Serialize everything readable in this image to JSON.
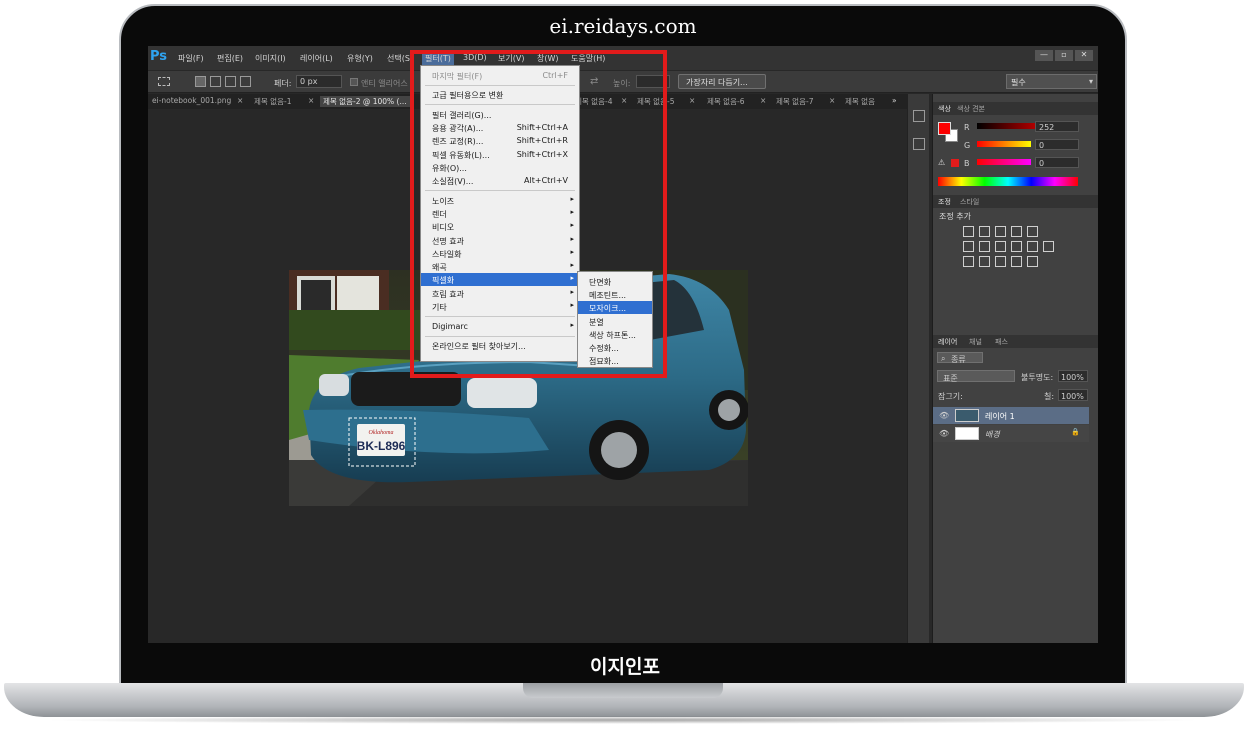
{
  "site_title": "ei.reidays.com",
  "bottom_label": "이지인포",
  "app": {
    "logo": "Ps",
    "menus": [
      "파일(F)",
      "편집(E)",
      "이미지(I)",
      "레이어(L)",
      "유형(Y)",
      "선택(S)",
      "필터(T)",
      "3D(D)",
      "보기(V)",
      "창(W)",
      "도움말(H)"
    ],
    "window_buttons": [
      "—",
      "▫",
      "✕"
    ]
  },
  "options_bar": {
    "feather_label": "페더:",
    "feather_value": "0 px",
    "antialias_label": "앤티 앨리어스",
    "height_label": "높이:",
    "refine_edge": "가장자리 다듬기...",
    "workspace": "필수"
  },
  "tabs": [
    "ei-notebook_001.png",
    "제목 없음-1",
    "제목 없음-2 @ 100% (...",
    "제목 없음-4",
    "제목 없음-5",
    "제목 없음-6",
    "제목 없음-7",
    "제목 없음"
  ],
  "tab_close": "×",
  "tab_overflow": "»",
  "filter_menu": {
    "items": [
      {
        "label": "마지막 필터(F)",
        "shortcut": "Ctrl+F",
        "disabled": true
      },
      {
        "label": "고급 필터용으로 변환",
        "shortcut": ""
      },
      {
        "label": "필터 갤러리(G)...",
        "shortcut": ""
      },
      {
        "label": "응용 광각(A)...",
        "shortcut": "Shift+Ctrl+A"
      },
      {
        "label": "렌즈 교정(R)...",
        "shortcut": "Shift+Ctrl+R"
      },
      {
        "label": "픽셀 유동화(L)...",
        "shortcut": "Shift+Ctrl+X"
      },
      {
        "label": "유화(O)...",
        "shortcut": ""
      },
      {
        "label": "소실점(V)...",
        "shortcut": "Alt+Ctrl+V"
      },
      {
        "label": "노이즈"
      },
      {
        "label": "렌더"
      },
      {
        "label": "비디오"
      },
      {
        "label": "선명 효과"
      },
      {
        "label": "스타일화"
      },
      {
        "label": "왜곡"
      },
      {
        "label": "픽셀화"
      },
      {
        "label": "흐림 효과"
      },
      {
        "label": "기타"
      },
      {
        "label": "Digimarc"
      },
      {
        "label": "온라인으로 필터 찾아보기..."
      }
    ],
    "submenu_arrow": "▸"
  },
  "pixelate_submenu": {
    "items": [
      "단면화",
      "메조틴트...",
      "모자이크...",
      "분열",
      "색상 하프톤...",
      "수정화...",
      "점묘화..."
    ]
  },
  "panels": {
    "color_tabs": [
      "색상",
      "색상 견본"
    ],
    "channels": [
      {
        "name": "R",
        "value": "252"
      },
      {
        "name": "G",
        "value": "0"
      },
      {
        "name": "B",
        "value": "0"
      }
    ],
    "adjust_tabs": [
      "조정",
      "스타일"
    ],
    "adjust_title": "조정 추가",
    "layers_tabs": [
      "레이어",
      "채널",
      "패스"
    ],
    "kind_label": "종류",
    "blend_mode": "표준",
    "opacity_label": "불투명도:",
    "opacity_value": "100%",
    "lock_label": "잠그기:",
    "fill_label": "칠:",
    "fill_value": "100%",
    "layers": [
      {
        "name": "레이어 1",
        "selected": true
      },
      {
        "name": "배경",
        "selected": false
      }
    ]
  },
  "photo": {
    "plate_state": "Oklahoma",
    "plate_number": "BK-L896"
  },
  "colors": {
    "accent_red": "#e21b1b",
    "menu_highlight": "#2f6fd1",
    "car_blue": "#2c6a86",
    "foreground": "#fc0000"
  },
  "icons": {
    "eye": "👁",
    "lock": "🔒"
  }
}
